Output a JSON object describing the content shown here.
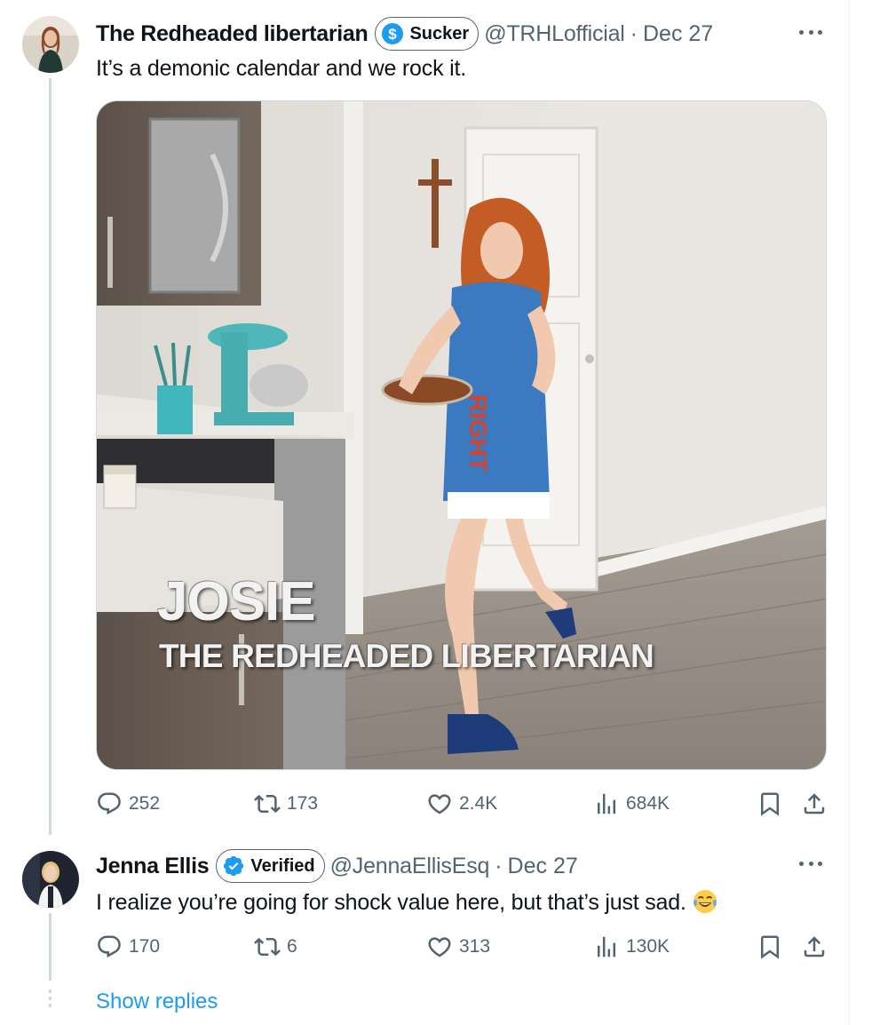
{
  "tweets": [
    {
      "author_name": "The Redheaded libertarian",
      "badge_label": "Sucker",
      "badge_icon": "dollar-icon",
      "handle": "@TRHLofficial",
      "separator": "·",
      "date": "Dec 27",
      "text": "It’s a demonic calendar and we rock it.",
      "media": {
        "overlay_title": "JOSIE",
        "overlay_subtitle": "THE REDHEADED LIBERTARIAN"
      },
      "stats": {
        "replies": "252",
        "reposts": "173",
        "likes": "2.4K",
        "views": "684K"
      }
    },
    {
      "author_name": "Jenna Ellis",
      "badge_label": "Verified",
      "badge_icon": "verified-check-icon",
      "handle": "@JennaEllisEsq",
      "separator": "·",
      "date": "Dec 27",
      "text": "I realize you’re going for shock value here, but that’s just sad.",
      "emoji": "joy-emoji-icon",
      "stats": {
        "replies": "170",
        "reposts": "6",
        "likes": "313",
        "views": "130K"
      }
    }
  ],
  "show_replies_label": "Show replies",
  "colors": {
    "text_primary": "#0f1419",
    "text_secondary": "#536471",
    "link_blue": "#1d9bf0",
    "thread_line": "#cfd9de"
  }
}
